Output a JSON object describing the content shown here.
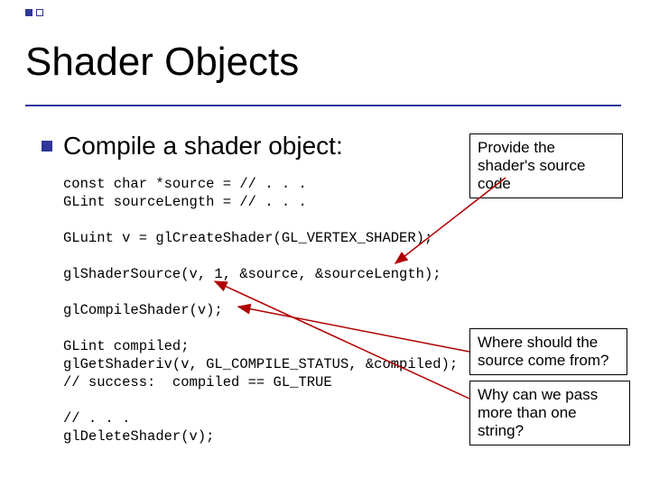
{
  "title": "Shader Objects",
  "subtitle": "Compile a shader object:",
  "code": {
    "l1": "const char *source = // . . .",
    "l2": "GLint sourceLength = // . . .",
    "l3": "",
    "l4": "GLuint v = glCreateShader(GL_VERTEX_SHADER);",
    "l5": "",
    "l6": "glShaderSource(v, 1, &source, &sourceLength);",
    "l7": "",
    "l8": "glCompileShader(v);",
    "l9": "",
    "l10": "GLint compiled;",
    "l11": "glGetShaderiv(v, GL_COMPILE_STATUS, &compiled);",
    "l12": "// success:  compiled == GL_TRUE",
    "l13": "",
    "l14": "// . . .",
    "l15": "glDeleteShader(v);"
  },
  "callouts": {
    "provide": "Provide the shader's source code",
    "where": "Where should the source come from?",
    "why": "Why can we pass more than one string?"
  }
}
